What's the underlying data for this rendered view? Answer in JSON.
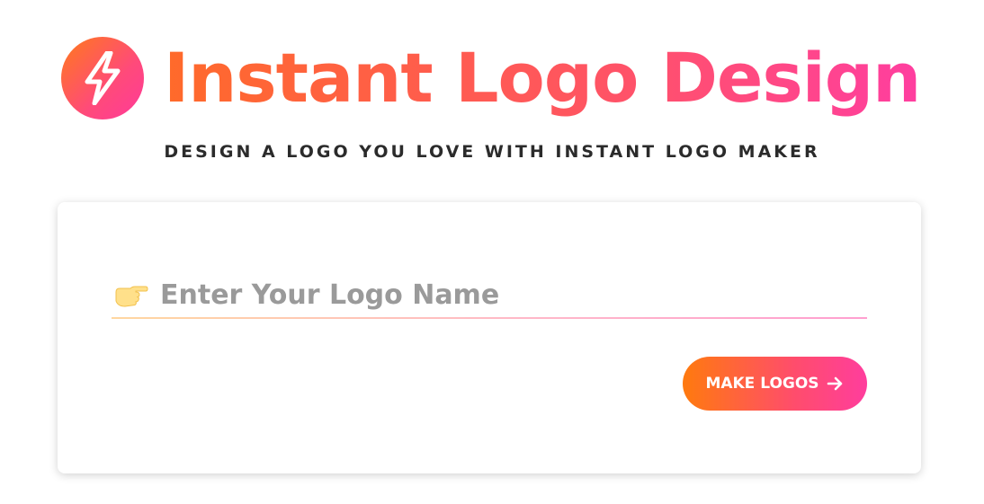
{
  "brand": {
    "title": "Instant Logo Design",
    "badge_icon": "lightning-bolt-icon",
    "gradient_start": "#ff7a1a",
    "gradient_end": "#ff3ea0"
  },
  "tagline": "DESIGN A LOGO YOU LOVE WITH INSTANT LOGO MAKER",
  "form": {
    "input_icon": "pointing-hand-icon",
    "input_placeholder": "Enter Your Logo Name",
    "input_value": "",
    "submit_label": "MAKE LOGOS",
    "submit_icon": "arrow-right-icon"
  }
}
